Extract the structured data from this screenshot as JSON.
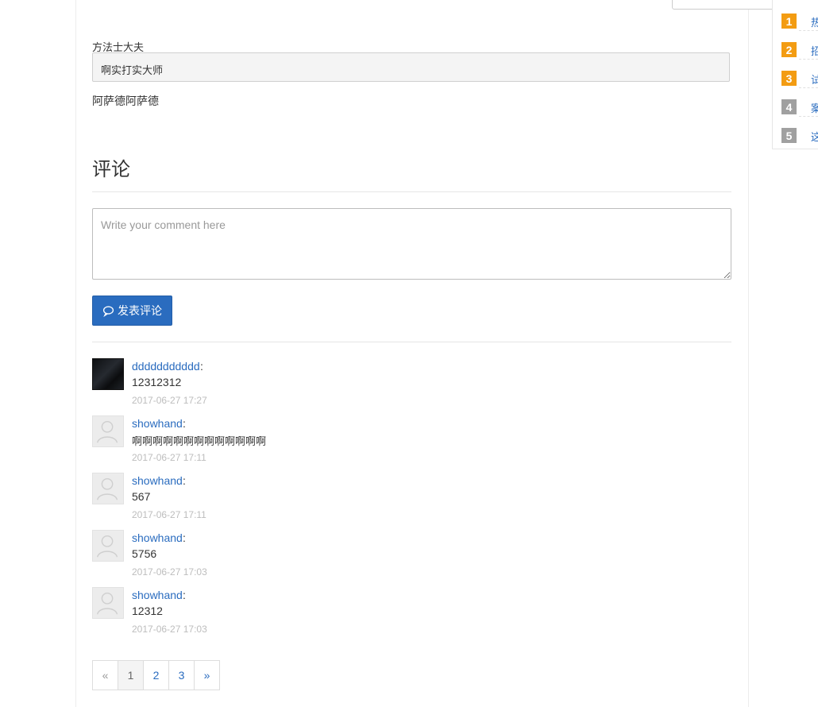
{
  "article": {
    "label_text": "方法士大夫",
    "quote_text": "啊实打实大师",
    "paragraph_text": "阿萨德阿萨德"
  },
  "comments_section": {
    "title": "评论",
    "input_placeholder": "Write your comment here",
    "submit_label": "发表评论",
    "items": [
      {
        "author": "ddddddddddd",
        "text": "12312312",
        "time": "2017-06-27 17:27",
        "avatar": "user-photo"
      },
      {
        "author": "showhand",
        "text": "啊啊啊啊啊啊啊啊啊啊啊啊啊",
        "time": "2017-06-27 17:11",
        "avatar": "default-user-icon"
      },
      {
        "author": "showhand",
        "text": "567",
        "time": "2017-06-27 17:11",
        "avatar": "default-user-icon"
      },
      {
        "author": "showhand",
        "text": "5756",
        "time": "2017-06-27 17:03",
        "avatar": "default-user-icon"
      },
      {
        "author": "showhand",
        "text": "12312",
        "time": "2017-06-27 17:03",
        "avatar": "default-user-icon"
      }
    ]
  },
  "pagination": {
    "prev": "«",
    "pages": [
      "1",
      "2",
      "3"
    ],
    "next": "»",
    "current": "1"
  },
  "sidebar_ranking": {
    "items": [
      {
        "rank": "1",
        "link": "热",
        "color": "#f39c12"
      },
      {
        "rank": "2",
        "link": "招",
        "color": "#f39c12"
      },
      {
        "rank": "3",
        "link": "试",
        "color": "#f39c12"
      },
      {
        "rank": "4",
        "link": "案",
        "color": "#a0a0a0"
      },
      {
        "rank": "5",
        "link": "这",
        "color": "#a0a0a0"
      }
    ]
  },
  "colors": {
    "accent": "#2a6cbf",
    "rank_hot": "#f39c12",
    "rank_cold": "#a0a0a0"
  }
}
